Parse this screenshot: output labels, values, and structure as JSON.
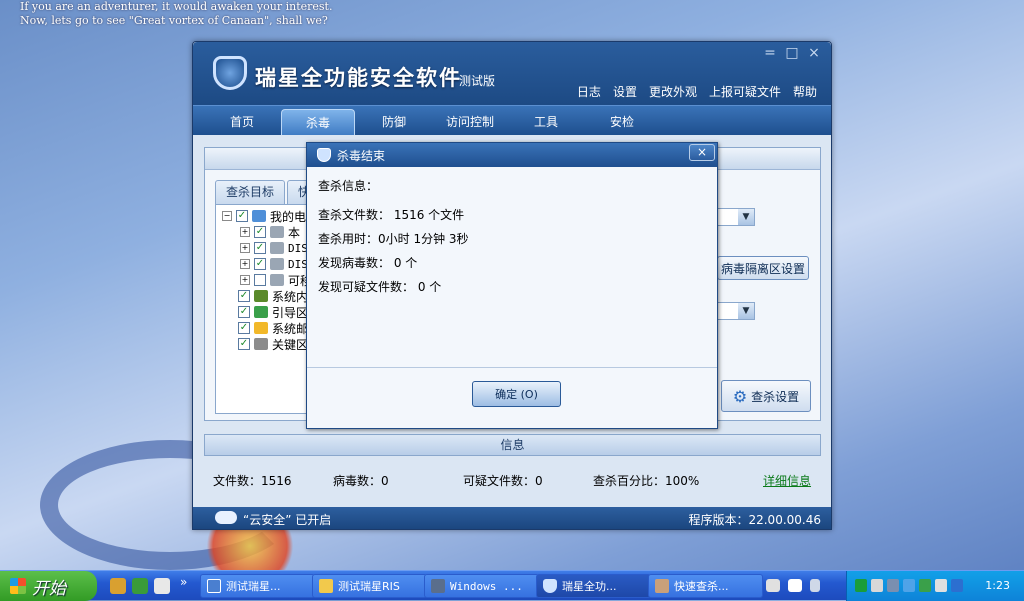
{
  "desktop": {
    "line1": "If you are an adventurer, it would awaken your interest.",
    "line2": "Now, lets go to see \"Great vortex of Canaan\", shall we?"
  },
  "window": {
    "title": "瑞星全功能安全软件",
    "edition": "测试版",
    "controls": [
      "=",
      "□",
      "×"
    ],
    "top_menu": [
      "日志",
      "设置",
      "更改外观",
      "上报可疑文件",
      "帮助"
    ],
    "nav_tabs": [
      "首页",
      "杀毒",
      "防御",
      "访问控制",
      "工具",
      "安检"
    ],
    "active_tab": "杀毒"
  },
  "scan_panel": {
    "sub_tabs": [
      "查杀目标",
      "快"
    ],
    "tree": [
      {
        "label": "我的电",
        "icon": "computer-icon"
      },
      {
        "label": "本",
        "icon": "drive-icon"
      },
      {
        "label": "DIS",
        "icon": "drive-icon"
      },
      {
        "label": "DIS",
        "icon": "drive-icon"
      },
      {
        "label": "可移",
        "icon": "drive-icon"
      },
      {
        "label": "系统内",
        "icon": "memory-icon"
      },
      {
        "label": "引导区",
        "icon": "boot-icon"
      },
      {
        "label": "系统邮",
        "icon": "mail-icon"
      },
      {
        "label": "关键区",
        "icon": "key-area-icon"
      }
    ],
    "quarantine_btn": "病毒隔离区设置",
    "scan_settings_btn": "查杀设置"
  },
  "info": {
    "header": "信息",
    "files": "文件数：1516",
    "viruses": "病毒数：0",
    "suspicious": "可疑文件数：0",
    "percent": "查杀百分比：100%",
    "detail_link": "详细信息"
  },
  "status": {
    "cloud": "“云安全” 已开启",
    "version": "程序版本：22.00.00.46"
  },
  "dialog": {
    "title": "杀毒结束",
    "close": "×",
    "heading": "查杀信息：",
    "files_scanned": "查杀文件数： 1516 个文件",
    "time_used": "查杀用时：0小时 1分钟 3秒",
    "viruses_found": "发现病毒数：   0 个",
    "suspicious_found": "发现可疑文件数：  0 个",
    "ok_btn": "确定 (O)"
  },
  "taskbar": {
    "start": "开始",
    "chevron": "»",
    "tasks": [
      "测试瑞星...",
      "测试瑞星RIS",
      "Windows ...",
      "瑞星全功...",
      "快速查杀..."
    ],
    "clock": "1:23"
  }
}
